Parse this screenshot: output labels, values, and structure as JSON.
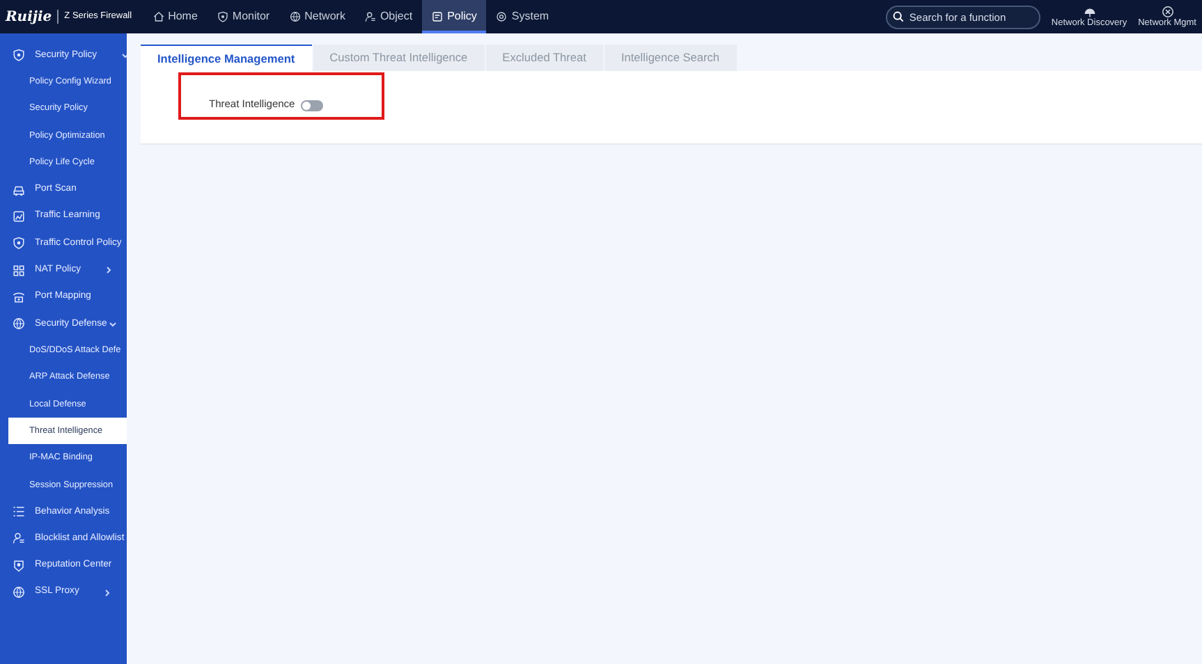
{
  "brand": {
    "logo": "Ruijie",
    "product": "Z Series Firewall"
  },
  "nav": [
    {
      "label": "Home",
      "selected": false
    },
    {
      "label": "Monitor",
      "selected": false
    },
    {
      "label": "Network",
      "selected": false
    },
    {
      "label": "Object",
      "selected": false
    },
    {
      "label": "Policy",
      "selected": true
    },
    {
      "label": "System",
      "selected": false
    }
  ],
  "search": {
    "placeholder": "Search for a function"
  },
  "actions": [
    {
      "label": "Network Discovery"
    },
    {
      "label": "Network Mgmt"
    }
  ],
  "sidebar": {
    "items": [
      {
        "label": "Security Policy",
        "kind": "group",
        "expanded": true,
        "selected": false,
        "children": [
          {
            "label": "Policy Config Wizard",
            "selected": false
          },
          {
            "label": "Security Policy",
            "selected": false
          },
          {
            "label": "Policy Optimization",
            "selected": false
          },
          {
            "label": "Policy Life Cycle",
            "selected": false
          }
        ]
      },
      {
        "label": "Port Scan",
        "kind": "page",
        "selected": false
      },
      {
        "label": "Traffic Learning",
        "kind": "page",
        "selected": false
      },
      {
        "label": "Traffic Control Policy",
        "kind": "page",
        "selected": false
      },
      {
        "label": "NAT Policy",
        "kind": "group",
        "expanded": false,
        "selected": false
      },
      {
        "label": "Port Mapping",
        "kind": "page",
        "selected": false
      },
      {
        "label": "Security Defense",
        "kind": "group",
        "expanded": true,
        "selected": false,
        "children": [
          {
            "label": "DoS/DDoS Attack Defe",
            "selected": false
          },
          {
            "label": "ARP Attack Defense",
            "selected": false
          },
          {
            "label": "Local Defense",
            "selected": false
          },
          {
            "label": "Threat Intelligence",
            "selected": true
          },
          {
            "label": "IP-MAC Binding",
            "selected": false
          },
          {
            "label": "Session Suppression",
            "selected": false
          }
        ]
      },
      {
        "label": "Behavior Analysis",
        "kind": "page",
        "selected": false
      },
      {
        "label": "Blocklist and Allowlist",
        "kind": "page",
        "selected": false
      },
      {
        "label": "Reputation Center",
        "kind": "page",
        "selected": false
      },
      {
        "label": "SSL Proxy",
        "kind": "group",
        "expanded": false,
        "selected": false
      }
    ]
  },
  "tabs": [
    {
      "label": "Intelligence Management",
      "selected": true
    },
    {
      "label": "Custom Threat Intelligence",
      "selected": false
    },
    {
      "label": "Excluded Threat",
      "selected": false
    },
    {
      "label": "Intelligence Search",
      "selected": false
    }
  ],
  "setting": {
    "label": "Threat Intelligence",
    "on": false,
    "highlighted": true
  }
}
